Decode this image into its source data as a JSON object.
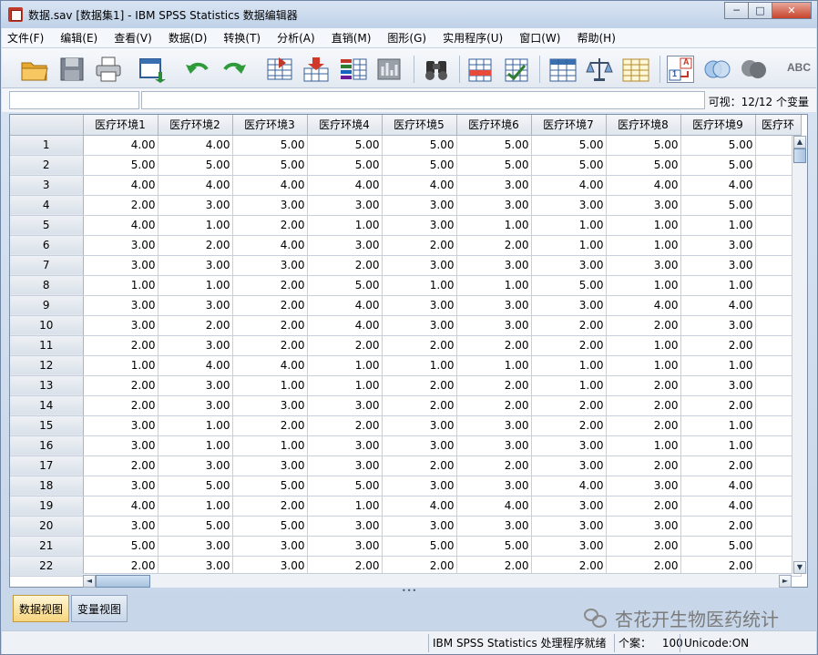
{
  "window": {
    "title": "数据.sav [数据集1] - IBM SPSS Statistics 数据编辑器",
    "minimize": "─",
    "maximize": "□",
    "close": "✕"
  },
  "menu": [
    "文件(F)",
    "编辑(E)",
    "查看(V)",
    "数据(D)",
    "转换(T)",
    "分析(A)",
    "直销(M)",
    "图形(G)",
    "实用程序(U)",
    "窗口(W)",
    "帮助(H)"
  ],
  "toolbar": {
    "icons": [
      "open-folder-icon",
      "save-icon",
      "print-icon",
      "dialog-recall-icon",
      "undo-icon",
      "redo-icon",
      "goto-case-icon",
      "goto-variable-icon",
      "variables-icon",
      "run-descriptives-icon",
      "find-icon",
      "insert-case-icon",
      "insert-variable-icon",
      "split-file-icon",
      "weight-cases-icon",
      "select-cases-icon",
      "value-labels-icon",
      "use-sets-icon",
      "show-all-variables-icon",
      "spell-check-icon"
    ],
    "value_labels_glyph": "A",
    "value_labels_num": "1",
    "spell_glyph": "ABC"
  },
  "editor": {
    "cell_ref": "",
    "cell_value": "",
    "visible_label": "可视：12/12 个变量"
  },
  "grid": {
    "columns": [
      "医疗环境1",
      "医疗环境2",
      "医疗环境3",
      "医疗环境4",
      "医疗环境5",
      "医疗环境6",
      "医疗环境7",
      "医疗环境8",
      "医疗环境9",
      "医疗环"
    ],
    "rows": [
      {
        "n": "1",
        "v": [
          "4.00",
          "4.00",
          "5.00",
          "5.00",
          "5.00",
          "5.00",
          "5.00",
          "5.00",
          "5.00"
        ]
      },
      {
        "n": "2",
        "v": [
          "5.00",
          "5.00",
          "5.00",
          "5.00",
          "5.00",
          "5.00",
          "5.00",
          "5.00",
          "5.00"
        ]
      },
      {
        "n": "3",
        "v": [
          "4.00",
          "4.00",
          "4.00",
          "4.00",
          "4.00",
          "3.00",
          "4.00",
          "4.00",
          "4.00"
        ]
      },
      {
        "n": "4",
        "v": [
          "2.00",
          "3.00",
          "3.00",
          "3.00",
          "3.00",
          "3.00",
          "3.00",
          "3.00",
          "5.00"
        ]
      },
      {
        "n": "5",
        "v": [
          "4.00",
          "1.00",
          "2.00",
          "1.00",
          "3.00",
          "1.00",
          "1.00",
          "1.00",
          "1.00"
        ]
      },
      {
        "n": "6",
        "v": [
          "3.00",
          "2.00",
          "4.00",
          "3.00",
          "2.00",
          "2.00",
          "1.00",
          "1.00",
          "3.00"
        ]
      },
      {
        "n": "7",
        "v": [
          "3.00",
          "3.00",
          "3.00",
          "2.00",
          "3.00",
          "3.00",
          "3.00",
          "3.00",
          "3.00"
        ]
      },
      {
        "n": "8",
        "v": [
          "1.00",
          "1.00",
          "2.00",
          "5.00",
          "1.00",
          "1.00",
          "5.00",
          "1.00",
          "1.00"
        ]
      },
      {
        "n": "9",
        "v": [
          "3.00",
          "3.00",
          "2.00",
          "4.00",
          "3.00",
          "3.00",
          "3.00",
          "4.00",
          "4.00"
        ]
      },
      {
        "n": "10",
        "v": [
          "3.00",
          "2.00",
          "2.00",
          "4.00",
          "3.00",
          "3.00",
          "2.00",
          "2.00",
          "3.00"
        ]
      },
      {
        "n": "11",
        "v": [
          "2.00",
          "3.00",
          "2.00",
          "2.00",
          "2.00",
          "2.00",
          "2.00",
          "1.00",
          "2.00"
        ]
      },
      {
        "n": "12",
        "v": [
          "1.00",
          "4.00",
          "4.00",
          "1.00",
          "1.00",
          "1.00",
          "1.00",
          "1.00",
          "1.00"
        ]
      },
      {
        "n": "13",
        "v": [
          "2.00",
          "3.00",
          "1.00",
          "1.00",
          "2.00",
          "2.00",
          "1.00",
          "2.00",
          "3.00"
        ]
      },
      {
        "n": "14",
        "v": [
          "2.00",
          "3.00",
          "3.00",
          "3.00",
          "2.00",
          "2.00",
          "2.00",
          "2.00",
          "2.00"
        ]
      },
      {
        "n": "15",
        "v": [
          "3.00",
          "1.00",
          "2.00",
          "2.00",
          "3.00",
          "3.00",
          "2.00",
          "2.00",
          "1.00"
        ]
      },
      {
        "n": "16",
        "v": [
          "3.00",
          "1.00",
          "1.00",
          "3.00",
          "3.00",
          "3.00",
          "3.00",
          "1.00",
          "1.00"
        ]
      },
      {
        "n": "17",
        "v": [
          "2.00",
          "3.00",
          "3.00",
          "3.00",
          "2.00",
          "2.00",
          "3.00",
          "2.00",
          "2.00"
        ]
      },
      {
        "n": "18",
        "v": [
          "3.00",
          "5.00",
          "5.00",
          "5.00",
          "3.00",
          "3.00",
          "4.00",
          "3.00",
          "4.00"
        ]
      },
      {
        "n": "19",
        "v": [
          "4.00",
          "1.00",
          "2.00",
          "1.00",
          "4.00",
          "4.00",
          "3.00",
          "2.00",
          "4.00"
        ]
      },
      {
        "n": "20",
        "v": [
          "3.00",
          "5.00",
          "5.00",
          "3.00",
          "3.00",
          "3.00",
          "3.00",
          "3.00",
          "2.00"
        ]
      },
      {
        "n": "21",
        "v": [
          "5.00",
          "3.00",
          "3.00",
          "3.00",
          "5.00",
          "5.00",
          "3.00",
          "2.00",
          "5.00"
        ]
      },
      {
        "n": "22",
        "v": [
          "2.00",
          "3.00",
          "3.00",
          "2.00",
          "2.00",
          "2.00",
          "2.00",
          "2.00",
          "2.00"
        ]
      }
    ]
  },
  "scroll": {
    "up": "▲",
    "down": "▼",
    "left": "◄",
    "right": "►",
    "splitter": "•••"
  },
  "tabs": {
    "data_view": "数据视图",
    "variable_view": "变量视图"
  },
  "watermark": "杏花开生物医药统计",
  "status": {
    "processor": "IBM SPSS Statistics 处理程序就绪",
    "cases_label": "个案：",
    "cases_value": "100",
    "unicode": "Unicode:ON"
  },
  "colors": {
    "accent": "#3a6fb0",
    "active_tab": "#f7d57e",
    "close_button": "#c7432b"
  }
}
